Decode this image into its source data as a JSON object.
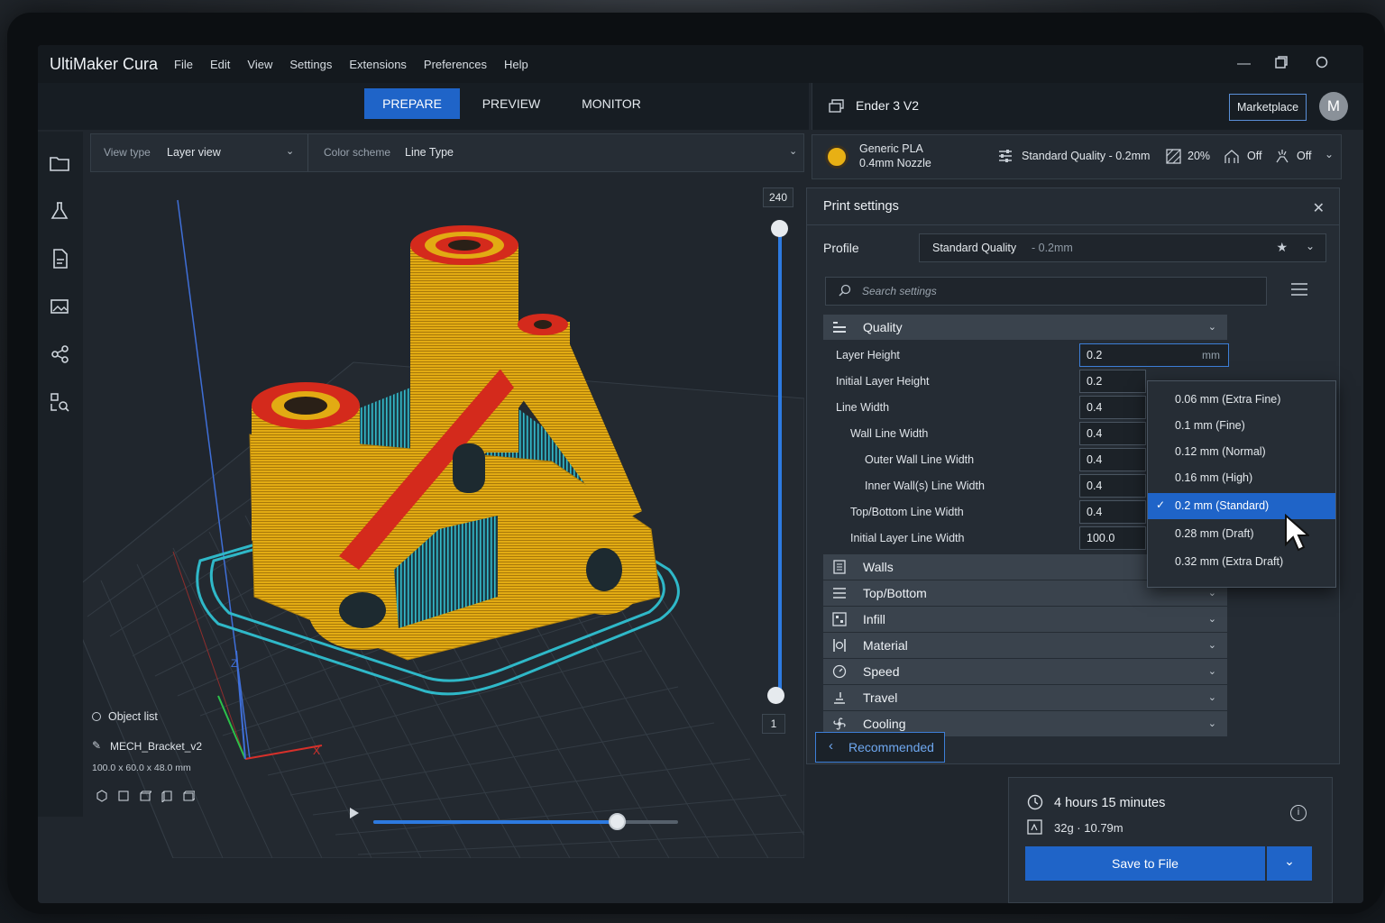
{
  "app": {
    "title": "UltiMaker Cura",
    "menu": [
      "File",
      "Edit",
      "View",
      "Settings",
      "Extensions",
      "Preferences",
      "Help"
    ]
  },
  "stages": [
    {
      "label": "PREPARE",
      "active": true
    },
    {
      "label": "PREVIEW",
      "active": false
    },
    {
      "label": "MONITOR",
      "active": false
    }
  ],
  "printer": {
    "name": "Ender 3 V2",
    "marketplace_label": "Marketplace",
    "avatar_initial": "M"
  },
  "view": {
    "view_type_label": "View type",
    "view_type_value": "Layer view",
    "color_scheme_label": "Color scheme",
    "color_scheme_value": "Line Type"
  },
  "layer_slider": {
    "top": "240",
    "bottom": "1"
  },
  "material_bar": {
    "material": "Generic PLA",
    "nozzle": "0.4mm Nozzle",
    "quality": "Standard Quality - 0.2mm",
    "infill": "20%",
    "support": "Off",
    "adhesion": "Off"
  },
  "print_settings": {
    "title": "Print settings",
    "profile_label": "Profile",
    "profile_name": "Standard Quality",
    "profile_suffix": "- 0.2mm",
    "search_placeholder": "Search settings",
    "quality_category": "Quality",
    "settings": [
      {
        "label": "Layer Height",
        "value": "0.2",
        "unit": "mm"
      },
      {
        "label": "Initial Layer Height",
        "value": "0.2"
      },
      {
        "label": "Line Width",
        "value": "0.4"
      },
      {
        "label": "Wall Line Width",
        "value": "0.4"
      },
      {
        "label": "Outer Wall Line Width",
        "value": "0.4"
      },
      {
        "label": "Inner Wall(s) Line Width",
        "value": "0.4"
      },
      {
        "label": "Top/Bottom Line Width",
        "value": "0.4"
      },
      {
        "label": "Initial Layer Line Width",
        "value": "100.0"
      }
    ],
    "categories": [
      "Walls",
      "Top/Bottom",
      "Infill",
      "Material",
      "Speed",
      "Travel",
      "Cooling"
    ],
    "recommended_label": "Recommended"
  },
  "layer_height_dropdown": {
    "options": [
      "0.06 mm (Extra Fine)",
      "0.1 mm (Fine)",
      "0.12 mm (Normal)",
      "0.16 mm (High)",
      "0.2 mm (Standard)",
      "0.28 mm (Draft)",
      "0.32 mm (Extra Draft)"
    ],
    "selected_index": 4
  },
  "objects": {
    "title": "Object list",
    "name": "MECH_Bracket_v2",
    "dimensions": "100.0 x 60.0 x 48.0 mm"
  },
  "axes": {
    "x": "X",
    "z": "Z"
  },
  "timeline": {
    "progress": 0.8
  },
  "estimate": {
    "time": "4 hours 15 minutes",
    "material": "32g · 10.79m",
    "save_label": "Save to File"
  },
  "colors": {
    "accent": "#1f64c8",
    "model_yellow": "#e8b014",
    "model_red": "#d42a1c",
    "support_cyan": "#2fb8c8"
  }
}
